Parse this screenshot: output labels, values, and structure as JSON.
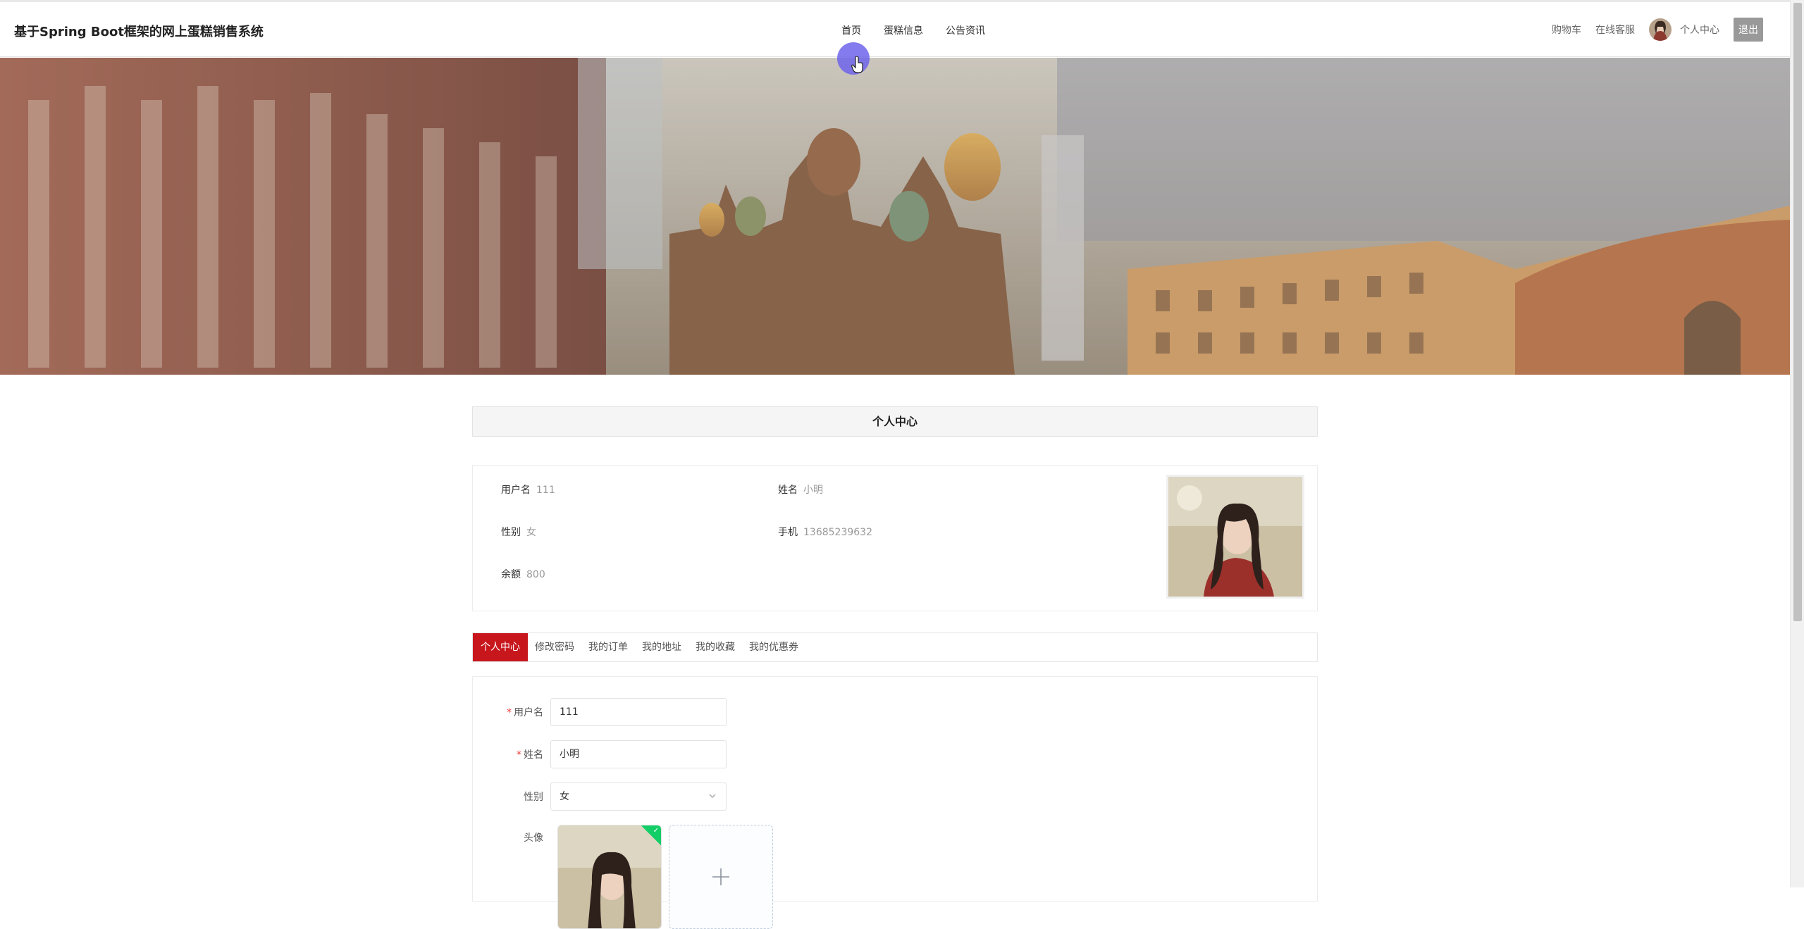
{
  "header": {
    "brand": "基于Spring Boot框架的网上蛋糕销售系统",
    "nav": [
      "首页",
      "蛋糕信息",
      "公告资讯"
    ],
    "cart": "购物车",
    "service": "在线客服",
    "profile": "个人中心",
    "logout": "退出"
  },
  "section_title": "个人中心",
  "info": {
    "username_label": "用户名",
    "username": "111",
    "name_label": "姓名",
    "name": "小明",
    "gender_label": "性别",
    "gender": "女",
    "phone_label": "手机",
    "phone": "13685239632",
    "balance_label": "余额",
    "balance": "800"
  },
  "tabs": [
    "个人中心",
    "修改密码",
    "我的订单",
    "我的地址",
    "我的收藏",
    "我的优惠券"
  ],
  "form": {
    "username_label": "用户名",
    "username": "111",
    "name_label": "姓名",
    "name": "小明",
    "gender_label": "性别",
    "gender": "女",
    "avatar_label": "头像"
  },
  "colors": {
    "accent": "#c8161d",
    "cursor": "#6e64eb",
    "success": "#13ce66"
  }
}
